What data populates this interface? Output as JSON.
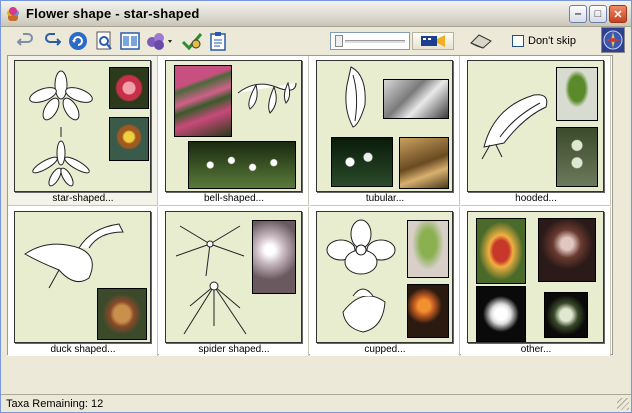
{
  "window": {
    "title": "Flower shape - star-shaped"
  },
  "toolbar": {
    "icons": [
      "undo-icon",
      "redo-icon",
      "refresh-icon",
      "preview-icon",
      "columns-icon",
      "multi-select-icon",
      "check-icon",
      "clipboard-icon"
    ],
    "dont_skip_label": "Don't skip",
    "dont_skip_checked": false
  },
  "cards": [
    {
      "label": "star-shaped...",
      "selected": true
    },
    {
      "label": "bell-shaped..."
    },
    {
      "label": "tubular..."
    },
    {
      "label": "hooded..."
    },
    {
      "label": "duck shaped..."
    },
    {
      "label": "spider shaped..."
    },
    {
      "label": "cupped..."
    },
    {
      "label": "other..."
    }
  ],
  "status": {
    "taxa_remaining": "Taxa Remaining: 12"
  },
  "colors": {
    "card_bg": "#e8edd0",
    "title_gradient_top": "#f4f3ee",
    "accent": "#316ac5"
  }
}
